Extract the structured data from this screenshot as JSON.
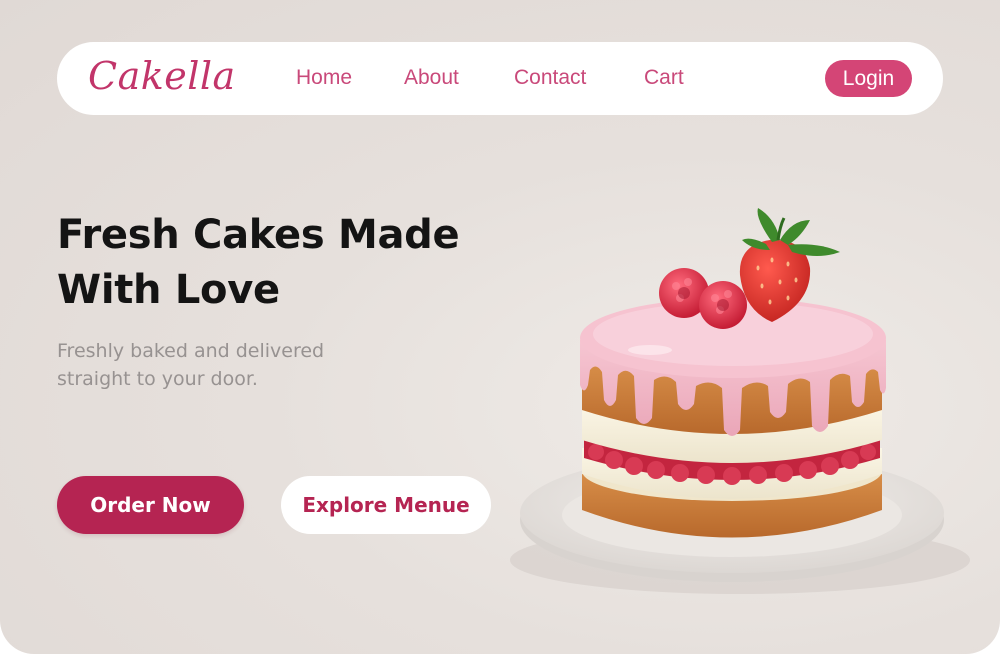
{
  "nav": {
    "logo": "Cakella",
    "links": [
      "Home",
      "About",
      "Contact",
      "Cart"
    ],
    "login_label": "Login"
  },
  "hero": {
    "title_line1": "Fresh Cakes Made",
    "title_line2": "With Love",
    "subtitle_line1": "Freshly baked and delivered",
    "subtitle_line2": "straight to your door.",
    "order_label": "Order Now",
    "explore_label": "Explore Menue"
  },
  "colors": {
    "brand_pink": "#d44576",
    "brand_crimson": "#b52452",
    "background": "#e4deda"
  },
  "icons": {
    "hero_image": "strawberry-drip-cake-image"
  }
}
